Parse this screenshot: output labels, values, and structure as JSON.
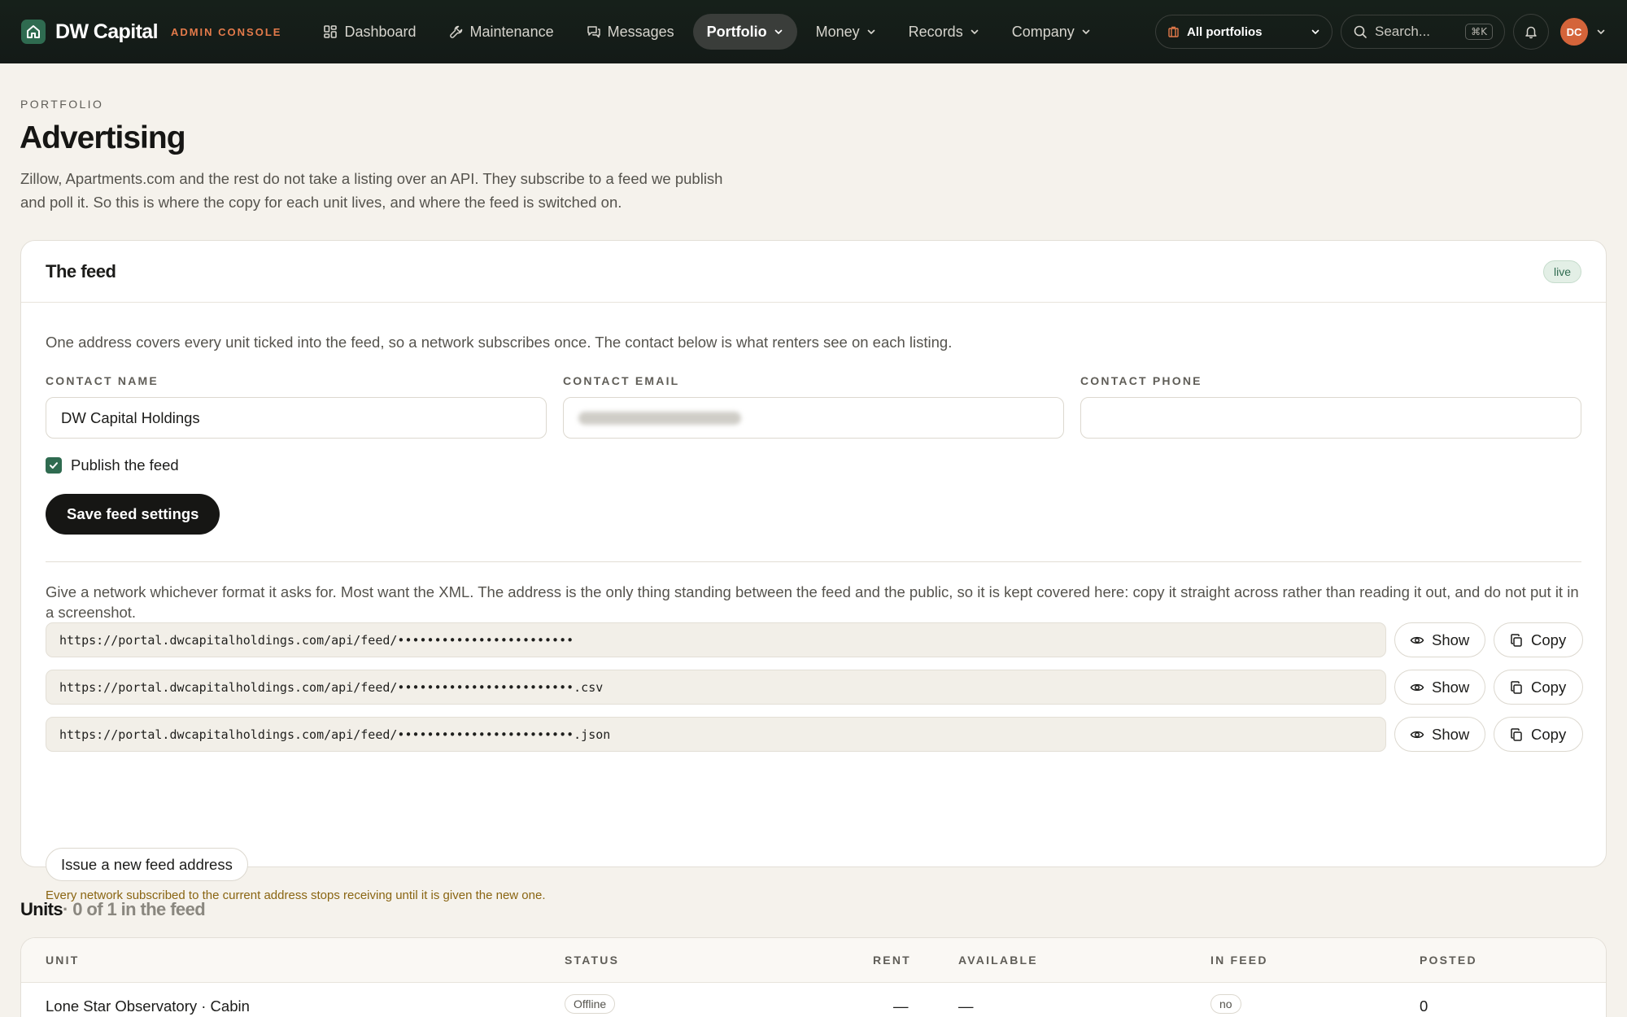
{
  "brand": {
    "name": "DW Capital",
    "tag": "ADMIN CONSOLE"
  },
  "nav": {
    "items": [
      {
        "label": "Dashboard",
        "icon": "dashboard-icon"
      },
      {
        "label": "Maintenance",
        "icon": "wrench-icon"
      },
      {
        "label": "Messages",
        "icon": "messages-icon"
      },
      {
        "label": "Portfolio",
        "active": true
      },
      {
        "label": "Money"
      },
      {
        "label": "Records"
      },
      {
        "label": "Company"
      }
    ],
    "portfolio_select": "All portfolios",
    "search_placeholder": "Search...",
    "search_shortcut": "⌘K",
    "avatar_initials": "DC"
  },
  "page": {
    "eyebrow": "PORTFOLIO",
    "title": "Advertising",
    "description": "Zillow, Apartments.com and the rest do not take a listing over an API. They subscribe to a feed we publish and poll it. So this is where the copy for each unit lives, and where the feed is switched on."
  },
  "feed": {
    "title": "The feed",
    "status_badge": "live",
    "lead": "One address covers every unit ticked into the feed, so a network subscribes once. The contact below is what renters see on each listing.",
    "fields": {
      "contact_name": {
        "label": "CONTACT NAME",
        "value": "DW Capital Holdings"
      },
      "contact_email": {
        "label": "CONTACT EMAIL",
        "value": ""
      },
      "contact_phone": {
        "label": "CONTACT PHONE",
        "value": ""
      }
    },
    "publish_label": "Publish the feed",
    "publish_checked": true,
    "save_label": "Save feed settings",
    "format_note": "Give a network whichever format it asks for. Most want the XML. The address is the only thing standing between the feed and the public, so it is kept covered here: copy it straight across rather than reading it out, and do not put it in a screenshot.",
    "urls": [
      "https://portal.dwcapitalholdings.com/api/feed/••••••••••••••••••••••••",
      "https://portal.dwcapitalholdings.com/api/feed/••••••••••••••••••••••••.csv",
      "https://portal.dwcapitalholdings.com/api/feed/••••••••••••••••••••••••.json"
    ],
    "show_label": "Show",
    "copy_label": "Copy",
    "reissue_label": "Issue a new feed address",
    "reissue_warning": "Every network subscribed to the current address stops receiving until it is given the new one."
  },
  "units": {
    "title": "Units",
    "summary": "· 0 of 1 in the feed",
    "columns": [
      "UNIT",
      "STATUS",
      "RENT",
      "AVAILABLE",
      "IN FEED",
      "POSTED"
    ],
    "rows": [
      {
        "unit": "Lone Star Observatory · Cabin",
        "status": "Offline",
        "rent": "—",
        "available": "—",
        "in_feed": "no",
        "posted": "0"
      }
    ]
  },
  "colors": {
    "nav_bg": "#141a17",
    "accent_green": "#2f6b50",
    "brand_tag": "#e37a4a",
    "avatar": "#d4643a",
    "warning_text": "#8a6512",
    "page_bg": "#f5f2ec"
  }
}
